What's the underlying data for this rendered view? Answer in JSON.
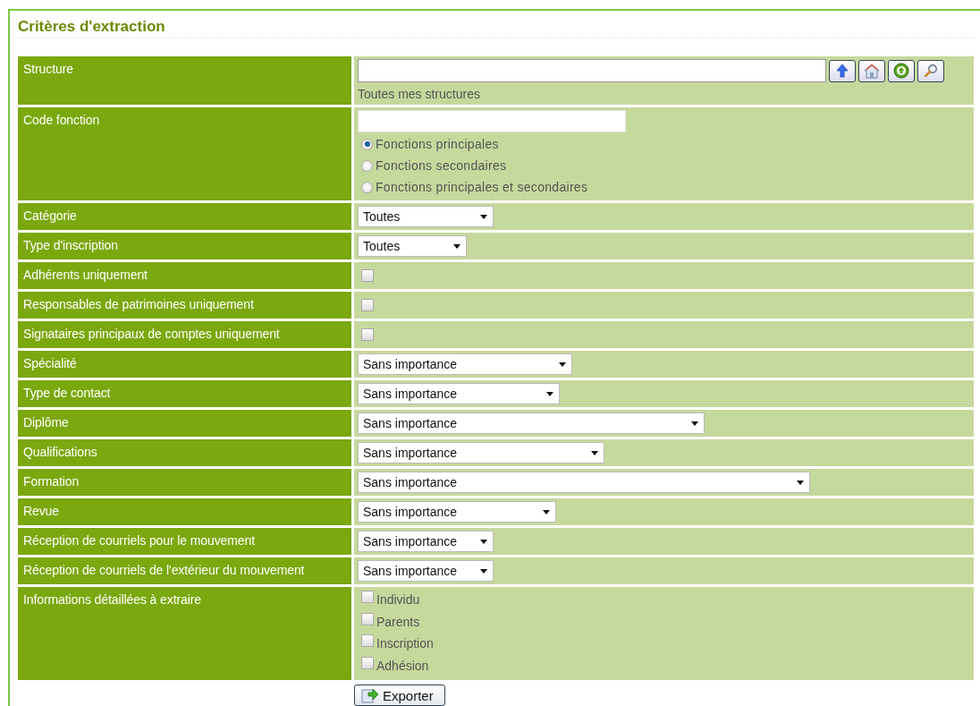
{
  "panel": {
    "title": "Critères d'extraction"
  },
  "rows": [
    {
      "label": "Structure",
      "kind": "structure",
      "hint": "Toutes mes structures"
    },
    {
      "label": "Code fonction",
      "kind": "code",
      "options": [
        {
          "label": "Fonctions principales",
          "selected": true
        },
        {
          "label": "Fonctions secondaires",
          "selected": false
        },
        {
          "label": "Fonctions principales et secondaires",
          "selected": false
        }
      ]
    },
    {
      "label": "Catégorie",
      "kind": "select",
      "value": "Toutes"
    },
    {
      "label": "Type d'inscription",
      "kind": "select",
      "value": "Toutes"
    },
    {
      "label": "Adhérents uniquement",
      "kind": "checkbox",
      "checked": false
    },
    {
      "label": "Responsables de patrimoines uniquement",
      "kind": "checkbox",
      "checked": false
    },
    {
      "label": "Signataires principaux de comptes uniquement",
      "kind": "checkbox",
      "checked": false
    },
    {
      "label": "Spécialité",
      "kind": "select",
      "value": "Sans importance"
    },
    {
      "label": "Type de contact",
      "kind": "select",
      "value": "Sans importance"
    },
    {
      "label": "Diplôme",
      "kind": "select",
      "value": "Sans importance"
    },
    {
      "label": "Qualifications",
      "kind": "select",
      "value": "Sans importance"
    },
    {
      "label": "Formation",
      "kind": "select",
      "value": "Sans importance"
    },
    {
      "label": "Revue",
      "kind": "select",
      "value": "Sans importance"
    },
    {
      "label": "Réception de courriels pour le mouvement",
      "kind": "select",
      "value": "Sans importance"
    },
    {
      "label": "Réception de courriels de l'extérieur du mouvement",
      "kind": "select",
      "value": "Sans importance"
    },
    {
      "label": "Informations détaillées à extraire",
      "kind": "checklist",
      "items": [
        {
          "label": "Individu",
          "checked": false
        },
        {
          "label": "Parents",
          "checked": false
        },
        {
          "label": "Inscription",
          "checked": false
        },
        {
          "label": "Adhésion",
          "checked": false
        }
      ]
    }
  ],
  "export_button": {
    "label": "Exporter"
  }
}
